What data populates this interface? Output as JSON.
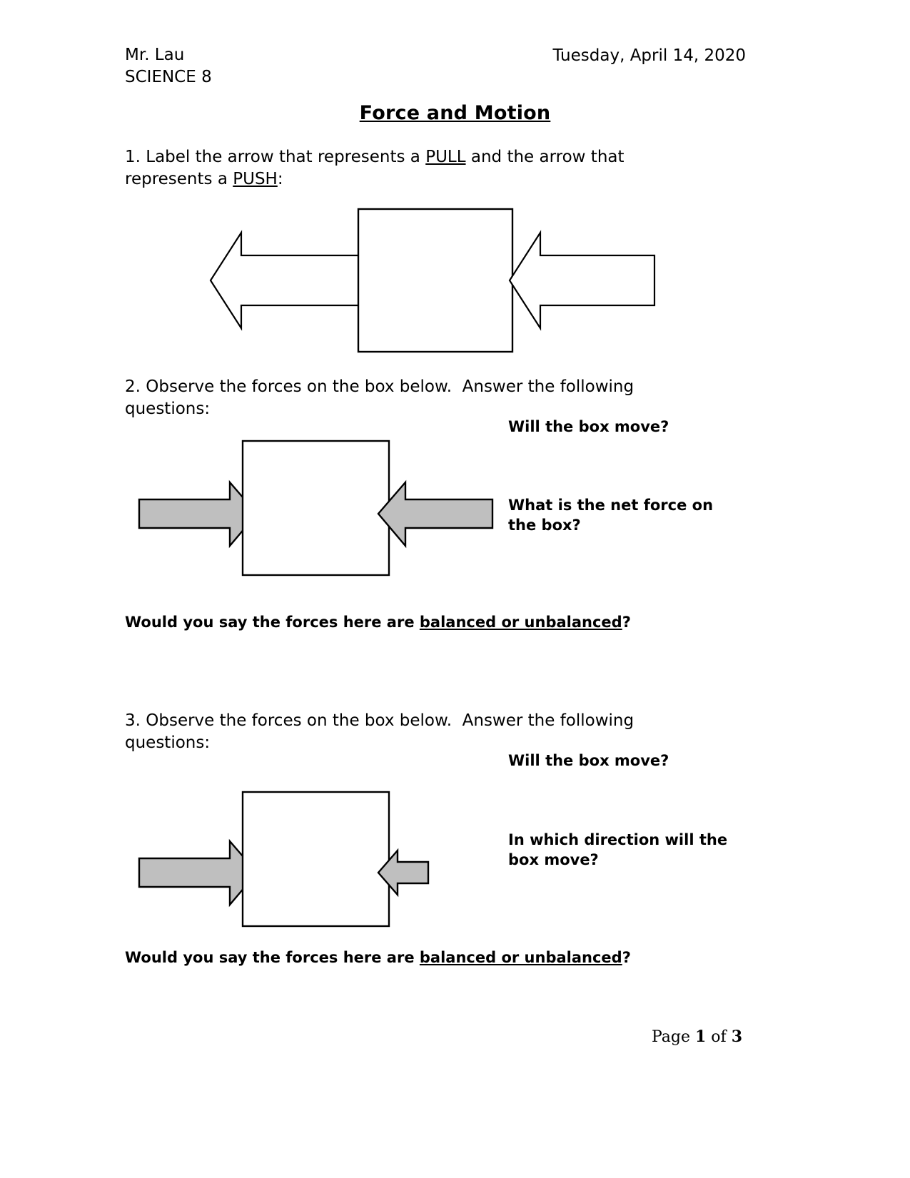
{
  "header": {
    "teacher": "Mr. Lau",
    "course": "SCIENCE 8",
    "date": "Tuesday, April 14, 2020"
  },
  "title": "Force and Motion",
  "questions": {
    "q1": {
      "number": "1.",
      "text_before": "1. Label the arrow that represents a ",
      "pull": "PULL",
      "text_middle": " and the arrow that represents a ",
      "push": "PUSH",
      "text_after": ":"
    },
    "q2": {
      "prompt": "2. Observe the forces on the box below.  Answer the following questions:",
      "side_question_1": "Will the box move?",
      "side_question_2": "What is the net force on the box?",
      "balanced_prefix": "Would you say the forces here are ",
      "balanced_underlined": "balanced or unbalanced",
      "balanced_suffix": "?"
    },
    "q3": {
      "prompt": "3. Observe the forces on the box below.  Answer the following questions:",
      "side_question_1": "Will the box move?",
      "side_question_2": "In which direction will the box move?",
      "balanced_prefix": "Would you say the forces here are ",
      "balanced_underlined": "balanced or unbalanced",
      "balanced_suffix": "?"
    }
  },
  "footer": {
    "page_label": "Page ",
    "page_number": "1",
    "of_label": " of ",
    "page_total": "3"
  },
  "figures": {
    "figure1": {
      "name": "push-pull-diagram",
      "box_fill": "#ffffff",
      "arrow_fill": "#ffffff",
      "stroke": "#000000",
      "left_arrow_direction": "left",
      "right_arrow_direction": "left"
    },
    "figure2": {
      "name": "balanced-forces-diagram",
      "box_fill": "#ffffff",
      "arrow_fill": "#bfbfbf",
      "stroke": "#000000",
      "left_arrow_direction": "right",
      "right_arrow_direction": "left",
      "left_arrow_size": "large",
      "right_arrow_size": "large"
    },
    "figure3": {
      "name": "unbalanced-forces-diagram",
      "box_fill": "#ffffff",
      "arrow_fill": "#bfbfbf",
      "stroke": "#000000",
      "left_arrow_direction": "right",
      "right_arrow_direction": "left",
      "left_arrow_size": "large",
      "right_arrow_size": "small"
    }
  }
}
